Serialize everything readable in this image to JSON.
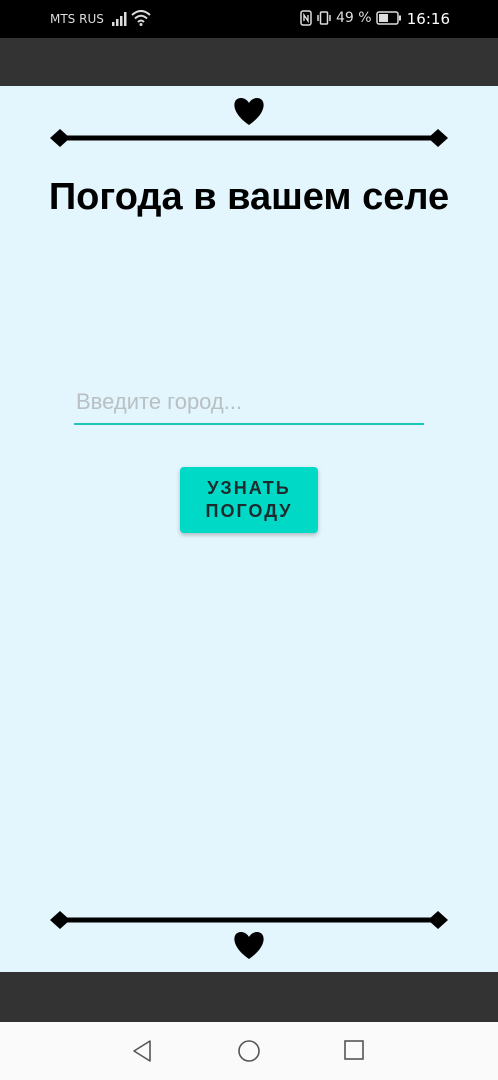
{
  "status_bar": {
    "carrier": "MTS RUS",
    "battery": "49 %",
    "time": "16:16",
    "icons": [
      "signal-icon",
      "wifi-icon",
      "nfc-icon",
      "vibrate-icon",
      "battery-icon"
    ]
  },
  "main": {
    "title": "Погода в вашем селе",
    "city_input": {
      "placeholder": "Введите город...",
      "value": ""
    },
    "submit_button": {
      "line1": "УЗНАТЬ",
      "line2": "ПОГОДУ"
    }
  },
  "nav_bar": {
    "icons": [
      "back-icon",
      "home-icon",
      "recents-icon"
    ]
  },
  "colors": {
    "background": "#e3f5fd",
    "bars": "#333333",
    "accent": "#00d9c6",
    "underline": "#1fc7b6"
  }
}
